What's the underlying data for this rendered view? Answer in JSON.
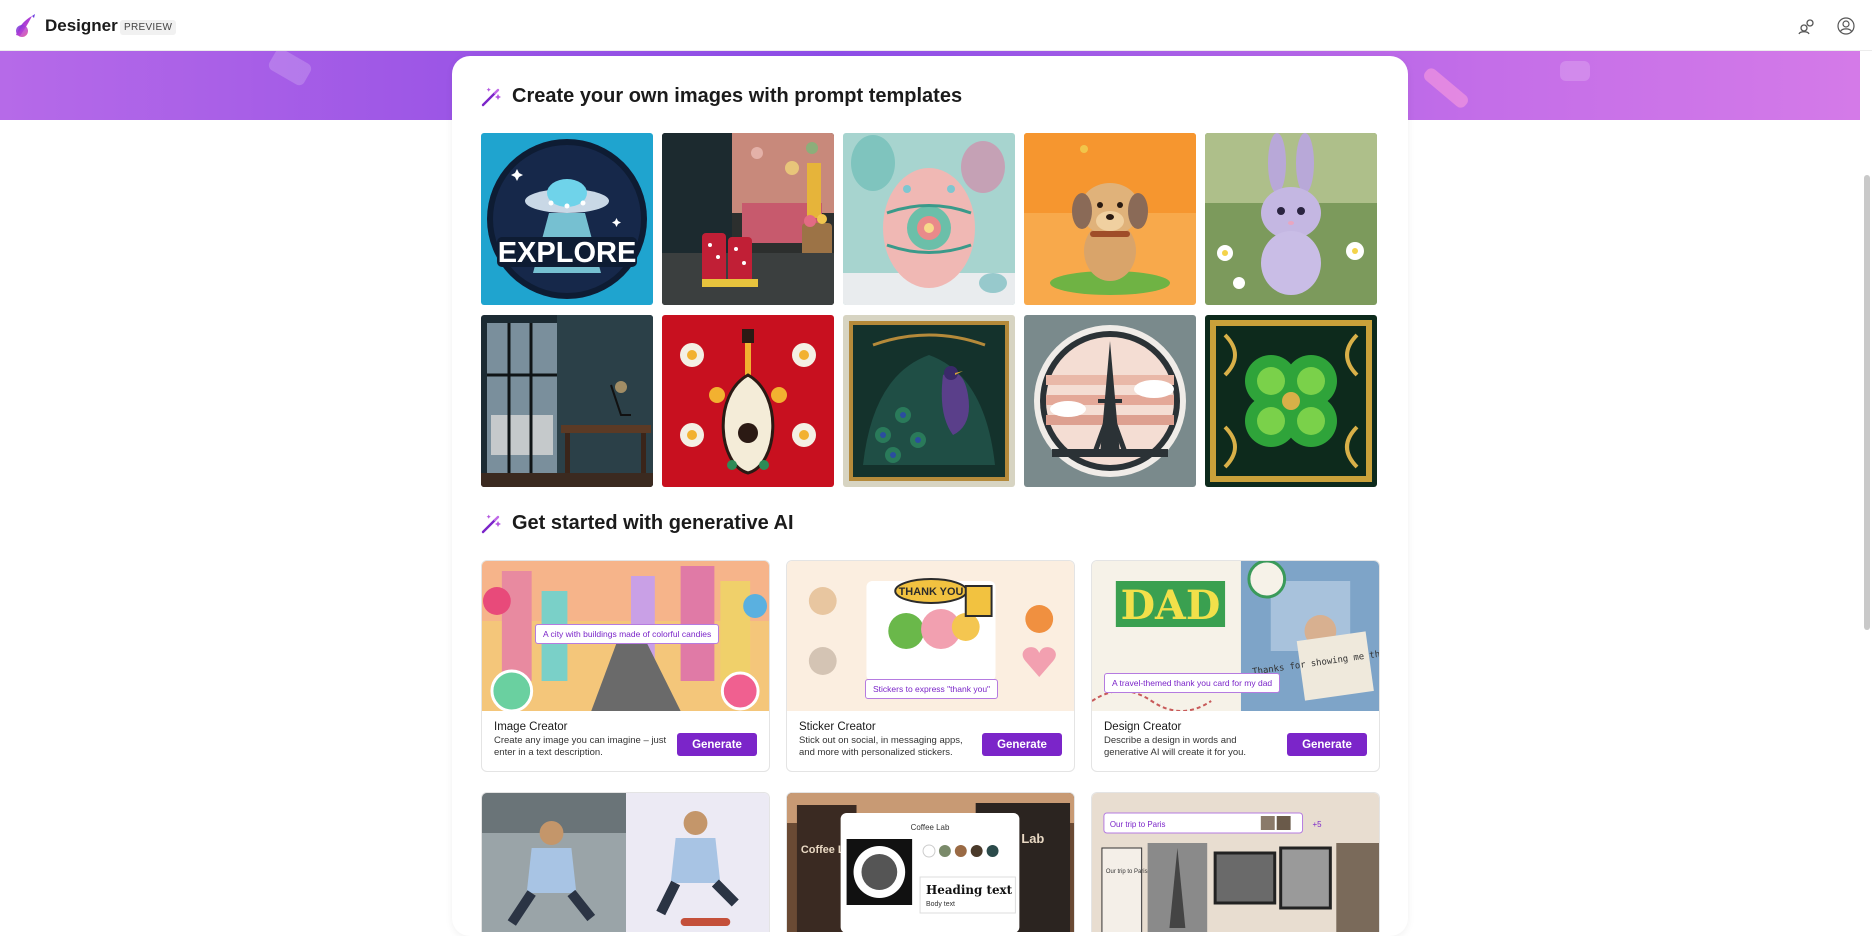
{
  "app": {
    "name": "Designer",
    "badge": "PREVIEW"
  },
  "header": {
    "icons": [
      "share-icon",
      "account-icon"
    ]
  },
  "templates": {
    "title": "Create your own images with prompt templates",
    "tiles": [
      {
        "name": "explore-ufo-sticker",
        "text": "EXPLORE"
      },
      {
        "name": "rain-boots-doorway"
      },
      {
        "name": "decorated-easter-egg"
      },
      {
        "name": "clay-puppy"
      },
      {
        "name": "purple-bunny-flowers"
      },
      {
        "name": "dark-office-window"
      },
      {
        "name": "folk-art-lute"
      },
      {
        "name": "art-nouveau-peacock"
      },
      {
        "name": "eiffel-tower-circle"
      },
      {
        "name": "golden-four-leaf-clover"
      }
    ]
  },
  "generative": {
    "title": "Get started with generative AI",
    "cards": [
      {
        "name": "Image Creator",
        "desc": "Create any image you can imagine – just enter in a text description.",
        "button": "Generate",
        "prompt": "A city with buildings made of colorful candies"
      },
      {
        "name": "Sticker Creator",
        "desc": "Stick out on social, in messaging apps, and more with personalized stickers.",
        "button": "Generate",
        "prompt": "Stickers to express \"thank you\"",
        "sticker_text": "THANK YOU"
      },
      {
        "name": "Design Creator",
        "desc": "Describe a design in words and generative AI will create it for you.",
        "button": "Generate",
        "prompt": "A travel-themed thank you card for my dad",
        "dad_text": "DAD",
        "note_text": "Thanks for showing me the world."
      }
    ],
    "partial_cards": [
      {
        "name": "background-removal-preview"
      },
      {
        "name": "brand-kit-preview",
        "brand": "Coffee Lab",
        "side": "Coffee Lab",
        "heading": "Heading text",
        "body": "Body text",
        "lab_right": "Lab"
      },
      {
        "name": "collage-preview",
        "prompt": "Our trip to Paris",
        "more": "+5",
        "card_text": "Our trip to Paris"
      }
    ]
  },
  "colors": {
    "accent": "#7b25c9",
    "banner": "#9b55e6"
  }
}
